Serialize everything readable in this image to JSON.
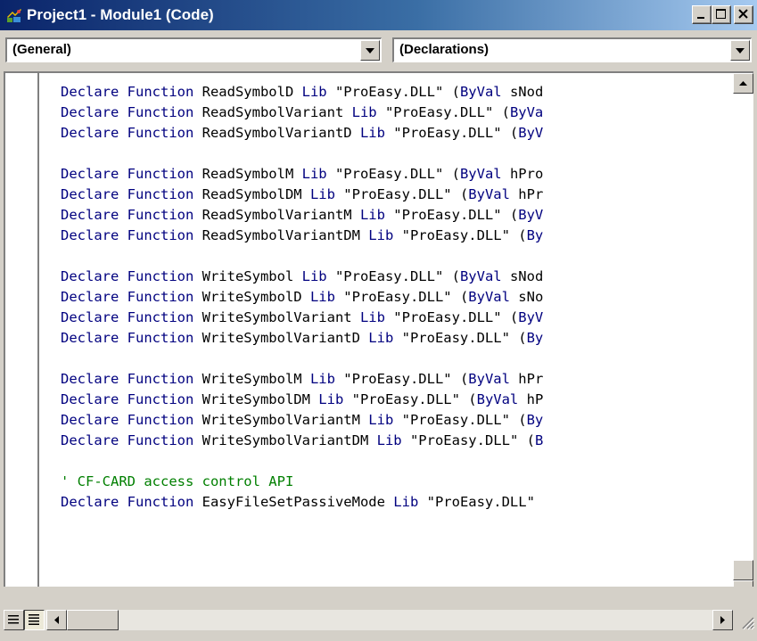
{
  "window": {
    "title": "Project1 - Module1 (Code)",
    "controls": {
      "minimize": "minimize",
      "maximize": "maximize",
      "close": "close"
    }
  },
  "combos": {
    "object": "(General)",
    "procedure": "(Declarations)"
  },
  "code_lines": [
    [
      {
        "t": "Declare Function",
        "c": "kw"
      },
      {
        "t": " ReadSymbolD "
      },
      {
        "t": "Lib",
        "c": "kw"
      },
      {
        "t": " \"ProEasy.DLL\" ("
      },
      {
        "t": "ByVal",
        "c": "kw"
      },
      {
        "t": " sNod"
      }
    ],
    [
      {
        "t": "Declare Function",
        "c": "kw"
      },
      {
        "t": " ReadSymbolVariant "
      },
      {
        "t": "Lib",
        "c": "kw"
      },
      {
        "t": " \"ProEasy.DLL\" ("
      },
      {
        "t": "ByVa",
        "c": "kw"
      }
    ],
    [
      {
        "t": "Declare Function",
        "c": "kw"
      },
      {
        "t": " ReadSymbolVariantD "
      },
      {
        "t": "Lib",
        "c": "kw"
      },
      {
        "t": " \"ProEasy.DLL\" ("
      },
      {
        "t": "ByV",
        "c": "kw"
      }
    ],
    [],
    [
      {
        "t": "Declare Function",
        "c": "kw"
      },
      {
        "t": " ReadSymbolM "
      },
      {
        "t": "Lib",
        "c": "kw"
      },
      {
        "t": " \"ProEasy.DLL\" ("
      },
      {
        "t": "ByVal",
        "c": "kw"
      },
      {
        "t": " hPro"
      }
    ],
    [
      {
        "t": "Declare Function",
        "c": "kw"
      },
      {
        "t": " ReadSymbolDM "
      },
      {
        "t": "Lib",
        "c": "kw"
      },
      {
        "t": " \"ProEasy.DLL\" ("
      },
      {
        "t": "ByVal",
        "c": "kw"
      },
      {
        "t": " hPr"
      }
    ],
    [
      {
        "t": "Declare Function",
        "c": "kw"
      },
      {
        "t": " ReadSymbolVariantM "
      },
      {
        "t": "Lib",
        "c": "kw"
      },
      {
        "t": " \"ProEasy.DLL\" ("
      },
      {
        "t": "ByV",
        "c": "kw"
      }
    ],
    [
      {
        "t": "Declare Function",
        "c": "kw"
      },
      {
        "t": " ReadSymbolVariantDM "
      },
      {
        "t": "Lib",
        "c": "kw"
      },
      {
        "t": " \"ProEasy.DLL\" ("
      },
      {
        "t": "By",
        "c": "kw"
      }
    ],
    [],
    [
      {
        "t": "Declare Function",
        "c": "kw"
      },
      {
        "t": " WriteSymbol "
      },
      {
        "t": "Lib",
        "c": "kw"
      },
      {
        "t": " \"ProEasy.DLL\" ("
      },
      {
        "t": "ByVal",
        "c": "kw"
      },
      {
        "t": " sNod"
      }
    ],
    [
      {
        "t": "Declare Function",
        "c": "kw"
      },
      {
        "t": " WriteSymbolD "
      },
      {
        "t": "Lib",
        "c": "kw"
      },
      {
        "t": " \"ProEasy.DLL\" ("
      },
      {
        "t": "ByVal",
        "c": "kw"
      },
      {
        "t": " sNo"
      }
    ],
    [
      {
        "t": "Declare Function",
        "c": "kw"
      },
      {
        "t": " WriteSymbolVariant "
      },
      {
        "t": "Lib",
        "c": "kw"
      },
      {
        "t": " \"ProEasy.DLL\" ("
      },
      {
        "t": "ByV",
        "c": "kw"
      }
    ],
    [
      {
        "t": "Declare Function",
        "c": "kw"
      },
      {
        "t": " WriteSymbolVariantD "
      },
      {
        "t": "Lib",
        "c": "kw"
      },
      {
        "t": " \"ProEasy.DLL\" ("
      },
      {
        "t": "By",
        "c": "kw"
      }
    ],
    [],
    [
      {
        "t": "Declare Function",
        "c": "kw"
      },
      {
        "t": " WriteSymbolM "
      },
      {
        "t": "Lib",
        "c": "kw"
      },
      {
        "t": " \"ProEasy.DLL\" ("
      },
      {
        "t": "ByVal",
        "c": "kw"
      },
      {
        "t": " hPr"
      }
    ],
    [
      {
        "t": "Declare Function",
        "c": "kw"
      },
      {
        "t": " WriteSymbolDM "
      },
      {
        "t": "Lib",
        "c": "kw"
      },
      {
        "t": " \"ProEasy.DLL\" ("
      },
      {
        "t": "ByVal",
        "c": "kw"
      },
      {
        "t": " hP"
      }
    ],
    [
      {
        "t": "Declare Function",
        "c": "kw"
      },
      {
        "t": " WriteSymbolVariantM "
      },
      {
        "t": "Lib",
        "c": "kw"
      },
      {
        "t": " \"ProEasy.DLL\" ("
      },
      {
        "t": "By",
        "c": "kw"
      }
    ],
    [
      {
        "t": "Declare Function",
        "c": "kw"
      },
      {
        "t": " WriteSymbolVariantDM "
      },
      {
        "t": "Lib",
        "c": "kw"
      },
      {
        "t": " \"ProEasy.DLL\" ("
      },
      {
        "t": "B",
        "c": "kw"
      }
    ],
    [],
    [
      {
        "t": "' CF-CARD access control API",
        "c": "cm"
      }
    ],
    [
      {
        "t": "Declare Function",
        "c": "kw"
      },
      {
        "t": " EasyFileSetPassiveMode "
      },
      {
        "t": "Lib",
        "c": "kw"
      },
      {
        "t": " \"ProEasy.DLL\""
      }
    ]
  ],
  "colors": {
    "keyword": "#00007f",
    "comment": "#007f00",
    "text": "#000000",
    "title_gradient_start": "#0a246a",
    "title_gradient_end": "#a6caf0",
    "chrome": "#d4d0c8"
  },
  "icons": [
    "app-icon",
    "minimize-icon",
    "maximize-icon",
    "close-icon",
    "dropdown-arrow-icon",
    "scroll-up-icon",
    "scroll-down-icon",
    "scroll-left-icon",
    "scroll-right-icon",
    "procedure-view-icon",
    "full-module-view-icon",
    "size-grip-icon"
  ]
}
